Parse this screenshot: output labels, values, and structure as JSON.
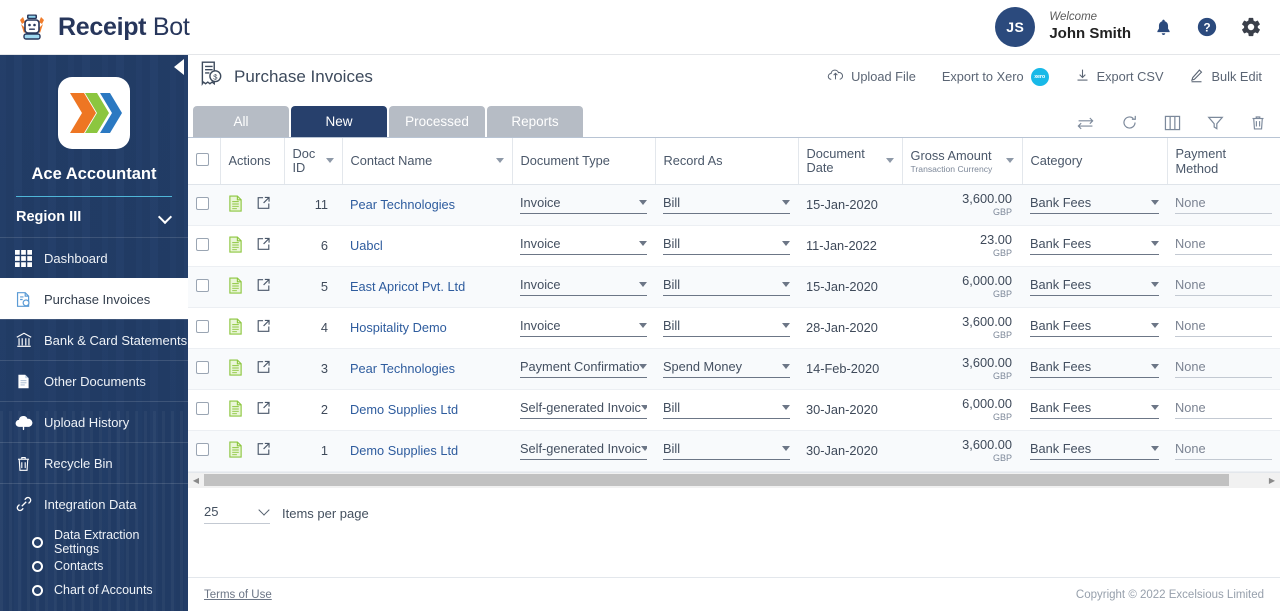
{
  "header": {
    "brand_bold": "Receipt",
    "brand_light": " Bot",
    "logo_icon": "receipt-bot-robot-icon",
    "avatar_initials": "JS",
    "welcome_label": "Welcome",
    "user_name": "John Smith",
    "notification_icon": "bell-icon",
    "help_icon": "help-circle-icon",
    "settings_icon": "gear-icon"
  },
  "sidebar": {
    "collapse_icon": "collapse-left-arrow-icon",
    "org_logo_icon": "ace-accountant-chevrons-logo",
    "org_name": "Ace Accountant",
    "region_label": "Region III",
    "region_chevron_icon": "chevron-down-icon",
    "items": [
      {
        "label": "Dashboard",
        "icon": "grid-dashboard-icon",
        "active": false
      },
      {
        "label": "Purchase Invoices",
        "icon": "invoice-document-icon",
        "active": true
      },
      {
        "label": "Bank & Card Statements",
        "icon": "bank-building-icon",
        "active": false
      },
      {
        "label": "Other Documents",
        "icon": "document-page-icon",
        "active": false
      },
      {
        "label": "Upload History",
        "icon": "cloud-upload-icon",
        "active": false
      },
      {
        "label": "Recycle Bin",
        "icon": "trash-bin-icon",
        "active": false
      },
      {
        "label": "Integration Data",
        "icon": "link-chain-icon",
        "active": false
      }
    ],
    "sub_items": [
      {
        "label": "Data Extraction Settings",
        "icon": "radio-circle-icon"
      },
      {
        "label": "Contacts",
        "icon": "radio-circle-icon"
      },
      {
        "label": "Chart of Accounts",
        "icon": "radio-circle-icon"
      }
    ]
  },
  "main": {
    "page_icon": "purchase-invoice-icon",
    "page_title": "Purchase Invoices",
    "head_actions": [
      {
        "label": "Upload File",
        "icon": "cloud-upload-icon"
      },
      {
        "label": "Export to Xero",
        "icon": "xero-badge-icon"
      },
      {
        "label": "Export CSV",
        "icon": "download-icon"
      },
      {
        "label": "Bulk Edit",
        "icon": "pencil-edit-icon"
      }
    ],
    "xero_badge_text": "xero",
    "tabs": [
      {
        "label": "All",
        "active": false
      },
      {
        "label": "New",
        "active": true
      },
      {
        "label": "Processed",
        "active": false
      },
      {
        "label": "Reports",
        "active": false
      }
    ],
    "tool_icons": [
      {
        "name": "swap-arrows-icon"
      },
      {
        "name": "refresh-icon"
      },
      {
        "name": "columns-icon"
      },
      {
        "name": "filter-funnel-icon"
      },
      {
        "name": "delete-trash-icon"
      }
    ]
  },
  "table": {
    "columns": [
      {
        "label": "",
        "sortable": false,
        "sub": ""
      },
      {
        "label": "Actions",
        "sortable": false,
        "sub": ""
      },
      {
        "label": "Doc ID",
        "sortable": true,
        "sub": ""
      },
      {
        "label": "Contact Name",
        "sortable": true,
        "sub": ""
      },
      {
        "label": "Document Type",
        "sortable": false,
        "sub": ""
      },
      {
        "label": "Record As",
        "sortable": false,
        "sub": ""
      },
      {
        "label": "Document Date",
        "sortable": true,
        "sub": ""
      },
      {
        "label": "Gross Amount",
        "sortable": true,
        "sub": "Transaction Currency"
      },
      {
        "label": "Category",
        "sortable": false,
        "sub": ""
      },
      {
        "label": "Payment Method",
        "sortable": false,
        "sub": ""
      }
    ],
    "row_icons": {
      "view": "green-document-icon",
      "open": "open-external-icon"
    },
    "rows": [
      {
        "doc_id": "11",
        "contact": "Pear Technologies",
        "doc_type": "Invoice",
        "record_as": "Bill",
        "date": "15-Jan-2020",
        "amount": "3,600.00",
        "currency": "GBP",
        "category": "Bank Fees",
        "payment_method": "None"
      },
      {
        "doc_id": "6",
        "contact": "Uabcl",
        "doc_type": "Invoice",
        "record_as": "Bill",
        "date": "11-Jan-2022",
        "amount": "23.00",
        "currency": "GBP",
        "category": "Bank Fees",
        "payment_method": "None"
      },
      {
        "doc_id": "5",
        "contact": "East Apricot Pvt. Ltd",
        "doc_type": "Invoice",
        "record_as": "Bill",
        "date": "15-Jan-2020",
        "amount": "6,000.00",
        "currency": "GBP",
        "category": "Bank Fees",
        "payment_method": "None"
      },
      {
        "doc_id": "4",
        "contact": "Hospitality Demo",
        "doc_type": "Invoice",
        "record_as": "Bill",
        "date": "28-Jan-2020",
        "amount": "3,600.00",
        "currency": "GBP",
        "category": "Bank Fees",
        "payment_method": "None"
      },
      {
        "doc_id": "3",
        "contact": "Pear Technologies",
        "doc_type": "Payment Confirmatio",
        "record_as": "Spend Money",
        "date": "14-Feb-2020",
        "amount": "3,600.00",
        "currency": "GBP",
        "category": "Bank Fees",
        "payment_method": "None"
      },
      {
        "doc_id": "2",
        "contact": "Demo Supplies Ltd",
        "doc_type": "Self-generated Invoic",
        "record_as": "Bill",
        "date": "30-Jan-2020",
        "amount": "6,000.00",
        "currency": "GBP",
        "category": "Bank Fees",
        "payment_method": "None"
      },
      {
        "doc_id": "1",
        "contact": "Demo Supplies Ltd",
        "doc_type": "Self-generated Invoic",
        "record_as": "Bill",
        "date": "30-Jan-2020",
        "amount": "3,600.00",
        "currency": "GBP",
        "category": "Bank Fees",
        "payment_method": "None"
      }
    ]
  },
  "pager": {
    "items_per_page_value": "25",
    "items_per_page_label": "Items per page",
    "scroll_left_icon": "scroll-left-arrow-icon",
    "scroll_right_icon": "scroll-right-arrow-icon"
  },
  "footer": {
    "terms_label": "Terms of Use",
    "copyright": "Copyright © 2022 Excelsious Limited"
  },
  "colors": {
    "navy": "#27406c",
    "tab_inactive": "#b6bcc5",
    "link_blue": "#2e5c9e",
    "xero_blue": "#18b9e8",
    "green_icon": "#8cc63f"
  }
}
